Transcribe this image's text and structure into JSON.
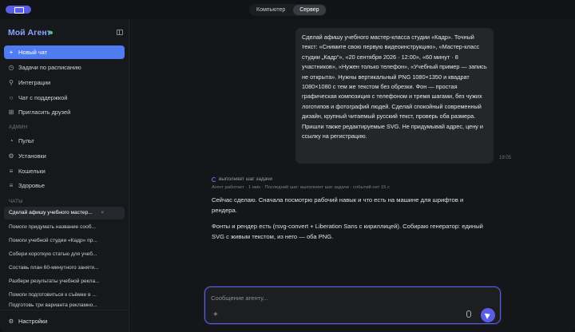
{
  "topbar": {
    "tabs": [
      {
        "label": "Компьютер",
        "active": false
      },
      {
        "label": "Сервер",
        "active": true
      }
    ]
  },
  "sidebar": {
    "brand": "Мой Агент",
    "nav": [
      {
        "icon": "plus-icon",
        "label": "Новый чат"
      },
      {
        "icon": "clock-icon",
        "label": "Задачи по расписанию"
      },
      {
        "icon": "plug-icon",
        "label": "Интеграции"
      },
      {
        "icon": "chat-icon",
        "label": "Чат с поддержкой"
      },
      {
        "icon": "gift-icon",
        "label": "Пригласить друзей"
      }
    ],
    "admin_label": "АДМИН",
    "admin": [
      {
        "icon": "dashboard-icon",
        "label": "Пульт"
      },
      {
        "icon": "settings-icon",
        "label": "Установки"
      },
      {
        "icon": "wallet-icon",
        "label": "Кошельки"
      },
      {
        "icon": "health-icon",
        "label": "Здоровье"
      }
    ],
    "chats_label": "ЧАТЫ",
    "chats": [
      "Сделай афишу учебного мастер...",
      "Помоги придумать название сооб...",
      "Помоги учебной студии «Кадр» пр...",
      "Собери короткую статью для учеб...",
      "Составь план 60-минутного заняти...",
      "Разбери результаты учебной рекла...",
      "Помоги подготовиться к съёмке в ...",
      "Подготовь три варианта рекламно..."
    ],
    "settings_label": "Настройки"
  },
  "main": {
    "user_message": "Сделай афишу учебного мастер-класса студии «Кадр». Точный текст: «Снимите свою первую видеоинструкцию», «Мастер-класс студии „Кадр“», «20 сентября 2026 · 12:00», «60 минут · 8 участников», «Нужен только телефон», «Учебный пример — запись не открыта». Нужны вертикальный PNG 1080×1350 и квадрат 1080×1080 с тем же текстом без обрезки. Фон — простая графическая композиция с телефоном и тремя шагами, без чужих логотипов и фотографий людей. Сделай спокойный современный дизайн, крупный читаемый русский текст, проверь оба размера. Пришли также редактируемые SVG. Не придумывай адрес, цену и ссылку на регистрацию.",
    "time": "19:05",
    "status": "выполняет шаг задачи",
    "meta": "Агент работает · 1 мин · Последний шаг: выполняет шаг задачи · событий нет 15 с",
    "reply_1": "Сейчас сделаю. Сначала посмотрю рабочий навык и что есть на машине для шрифтов и рендера.",
    "reply_2": "Фонты и рендер есть (rsvg-convert + Liberation Sans с кириллицей). Собираю генератор: единый SVG с живым текстом, из него — оба PNG."
  },
  "composer": {
    "placeholder": "Сообщение агенту..."
  },
  "colors": {
    "accent": "#5a5ee6",
    "primary_button": "#4f7cf0",
    "brand": "#8aa4ff",
    "online": "#3fcf6a"
  }
}
